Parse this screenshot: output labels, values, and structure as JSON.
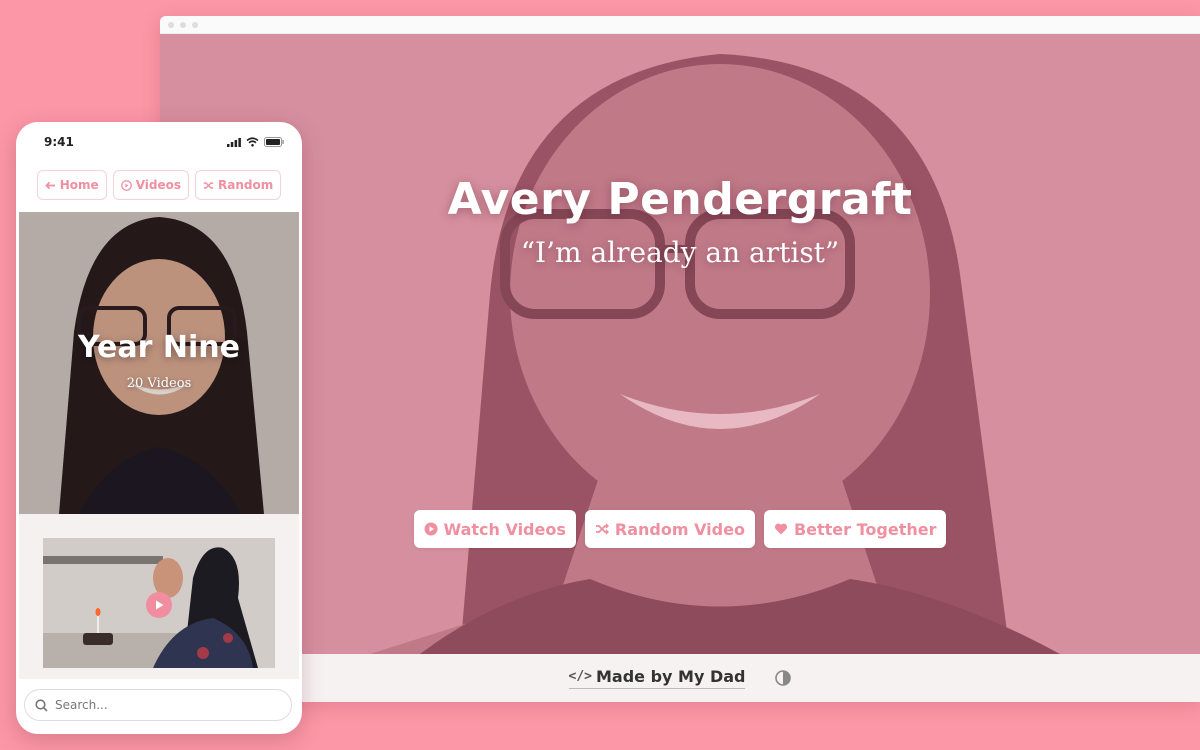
{
  "desktop": {
    "hero": {
      "title": "Avery Pendergraft",
      "quote": "“I’m already an artist”",
      "tint_color": "#d6788c"
    },
    "buttons": [
      {
        "label": "Watch Videos",
        "icon": "play-circle-icon"
      },
      {
        "label": "Random Video",
        "icon": "shuffle-icon"
      },
      {
        "label": "Better Together",
        "icon": "heart-icon"
      }
    ],
    "footer": {
      "made_by": "Made by My Dad",
      "code_icon": "</>",
      "contrast_icon": "contrast-icon"
    }
  },
  "mobile": {
    "status": {
      "time": "9:41"
    },
    "nav": [
      {
        "label": "Home",
        "icon": "arrow-left-icon"
      },
      {
        "label": "Videos",
        "icon": "play-circle-icon"
      },
      {
        "label": "Random",
        "icon": "shuffle-icon"
      }
    ],
    "hero": {
      "title": "Year Nine",
      "subtitle": "20 Videos"
    },
    "search": {
      "placeholder": "Search..."
    }
  },
  "colors": {
    "background": "#fb97a6",
    "accent": "#ef8fa0",
    "footer_bg": "#f6f2f2"
  }
}
